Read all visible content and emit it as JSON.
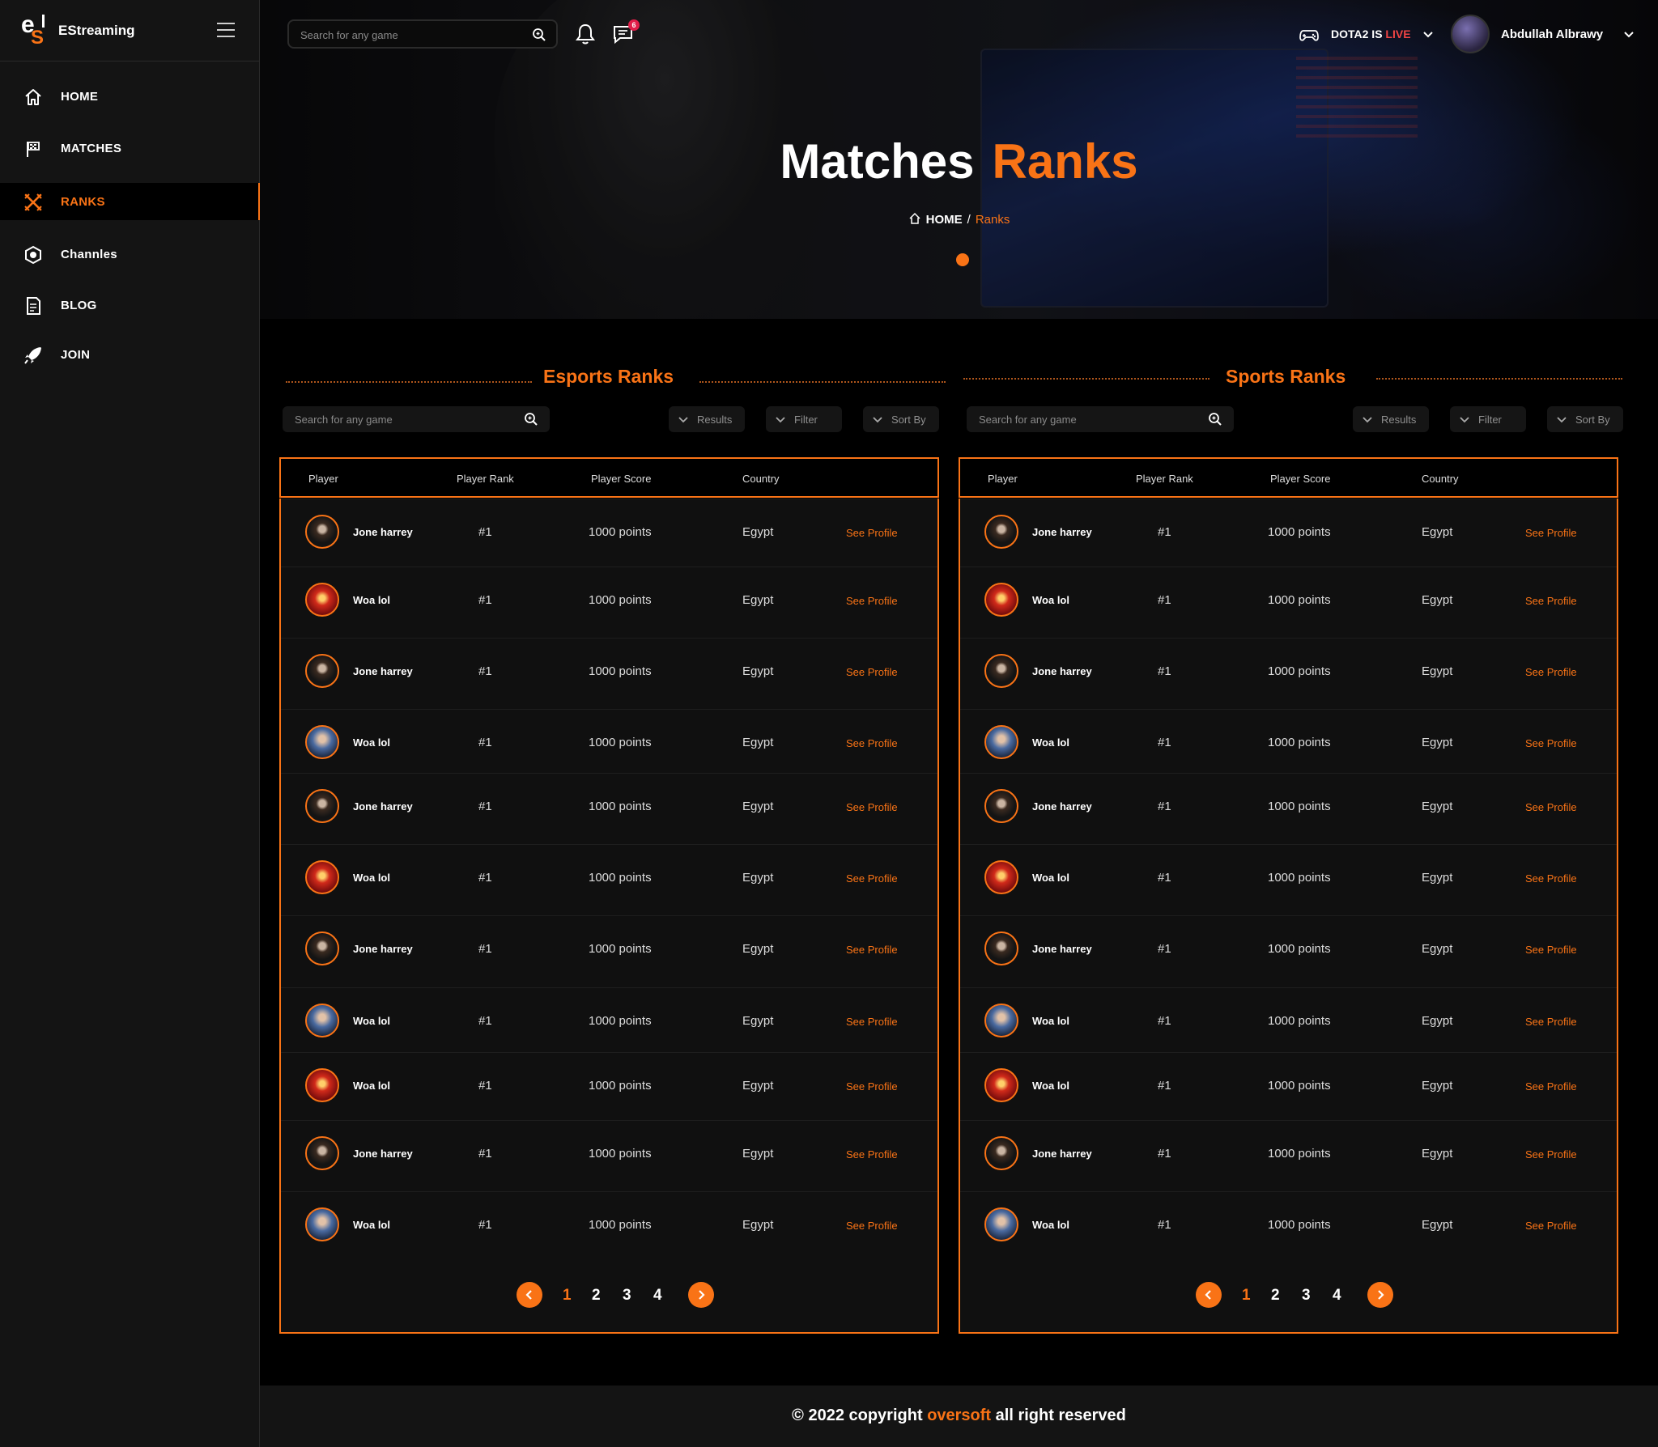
{
  "app": {
    "name": "EStreaming",
    "logo_text": "eS"
  },
  "nav": [
    {
      "label": "HOME",
      "icon": "home-icon",
      "active": false
    },
    {
      "label": "MATCHES",
      "icon": "flag-icon",
      "active": false
    },
    {
      "label": "RANKS",
      "icon": "crossed-swords-icon",
      "active": true
    },
    {
      "label": "Channles",
      "icon": "channels-icon",
      "active": false
    },
    {
      "label": "BLOG",
      "icon": "document-icon",
      "active": false
    },
    {
      "label": "JOIN",
      "icon": "rocket-icon",
      "active": false
    }
  ],
  "topbar": {
    "search_placeholder": "Search for any game",
    "message_badge": "6",
    "live_prefix": "DOTA2 IS",
    "live_word": "LIVE",
    "user_name": "Abdullah Albrawy"
  },
  "hero": {
    "title_part1": "Matches",
    "title_part2": "Ranks",
    "breadcrumb_home": "HOME",
    "breadcrumb_sep": "/",
    "breadcrumb_current": "Ranks"
  },
  "colors": {
    "accent": "#f97316",
    "live": "#ef4444",
    "background": "#000000",
    "panel": "#101010"
  },
  "panels": [
    {
      "title_part1": "Esports",
      "title_part2": "Ranks",
      "search_placeholder": "Search for any game",
      "filters": [
        "Results",
        "Filter",
        "Sort By"
      ],
      "columns": [
        "Player",
        "Player Rank",
        "Player Score",
        "Country"
      ],
      "rows": [
        {
          "name": "Jone harrey",
          "rank": "#1",
          "score": "1000 points",
          "country": "Egypt",
          "action": "See Profile",
          "avatar": "dark"
        },
        {
          "name": "Woa lol",
          "rank": "#1",
          "score": "1000 points",
          "country": "Egypt",
          "action": "See Profile",
          "avatar": "red"
        },
        {
          "name": "Jone harrey",
          "rank": "#1",
          "score": "1000 points",
          "country": "Egypt",
          "action": "See Profile",
          "avatar": "dark"
        },
        {
          "name": "Woa lol",
          "rank": "#1",
          "score": "1000 points",
          "country": "Egypt",
          "action": "See Profile",
          "avatar": "blue"
        },
        {
          "name": "Jone harrey",
          "rank": "#1",
          "score": "1000 points",
          "country": "Egypt",
          "action": "See Profile",
          "avatar": "dark"
        },
        {
          "name": "Woa lol",
          "rank": "#1",
          "score": "1000 points",
          "country": "Egypt",
          "action": "See Profile",
          "avatar": "red"
        },
        {
          "name": "Jone harrey",
          "rank": "#1",
          "score": "1000 points",
          "country": "Egypt",
          "action": "See Profile",
          "avatar": "dark"
        },
        {
          "name": "Woa lol",
          "rank": "#1",
          "score": "1000 points",
          "country": "Egypt",
          "action": "See Profile",
          "avatar": "blue"
        },
        {
          "name": "Woa lol",
          "rank": "#1",
          "score": "1000 points",
          "country": "Egypt",
          "action": "See Profile",
          "avatar": "red"
        },
        {
          "name": "Jone harrey",
          "rank": "#1",
          "score": "1000 points",
          "country": "Egypt",
          "action": "See Profile",
          "avatar": "dark"
        },
        {
          "name": "Woa lol",
          "rank": "#1",
          "score": "1000 points",
          "country": "Egypt",
          "action": "See Profile",
          "avatar": "blue"
        }
      ],
      "pages": [
        "1",
        "2",
        "3",
        "4"
      ],
      "current_page": "1"
    },
    {
      "title_part1": "Sports",
      "title_part2": "Ranks",
      "search_placeholder": "Search for any game",
      "filters": [
        "Results",
        "Filter",
        "Sort By"
      ],
      "columns": [
        "Player",
        "Player Rank",
        "Player Score",
        "Country"
      ],
      "rows": [
        {
          "name": "Jone harrey",
          "rank": "#1",
          "score": "1000 points",
          "country": "Egypt",
          "action": "See Profile",
          "avatar": "dark"
        },
        {
          "name": "Woa lol",
          "rank": "#1",
          "score": "1000 points",
          "country": "Egypt",
          "action": "See Profile",
          "avatar": "red"
        },
        {
          "name": "Jone harrey",
          "rank": "#1",
          "score": "1000 points",
          "country": "Egypt",
          "action": "See Profile",
          "avatar": "dark"
        },
        {
          "name": "Woa lol",
          "rank": "#1",
          "score": "1000 points",
          "country": "Egypt",
          "action": "See Profile",
          "avatar": "blue"
        },
        {
          "name": "Jone harrey",
          "rank": "#1",
          "score": "1000 points",
          "country": "Egypt",
          "action": "See Profile",
          "avatar": "dark"
        },
        {
          "name": "Woa lol",
          "rank": "#1",
          "score": "1000 points",
          "country": "Egypt",
          "action": "See Profile",
          "avatar": "red"
        },
        {
          "name": "Jone harrey",
          "rank": "#1",
          "score": "1000 points",
          "country": "Egypt",
          "action": "See Profile",
          "avatar": "dark"
        },
        {
          "name": "Woa lol",
          "rank": "#1",
          "score": "1000 points",
          "country": "Egypt",
          "action": "See Profile",
          "avatar": "blue"
        },
        {
          "name": "Woa lol",
          "rank": "#1",
          "score": "1000 points",
          "country": "Egypt",
          "action": "See Profile",
          "avatar": "red"
        },
        {
          "name": "Jone harrey",
          "rank": "#1",
          "score": "1000 points",
          "country": "Egypt",
          "action": "See Profile",
          "avatar": "dark"
        },
        {
          "name": "Woa lol",
          "rank": "#1",
          "score": "1000 points",
          "country": "Egypt",
          "action": "See Profile",
          "avatar": "blue"
        }
      ],
      "pages": [
        "1",
        "2",
        "3",
        "4"
      ],
      "current_page": "1"
    }
  ],
  "footer": {
    "prefix": "© 2022 copyright",
    "company": "oversoft",
    "suffix": "all right reserved"
  }
}
